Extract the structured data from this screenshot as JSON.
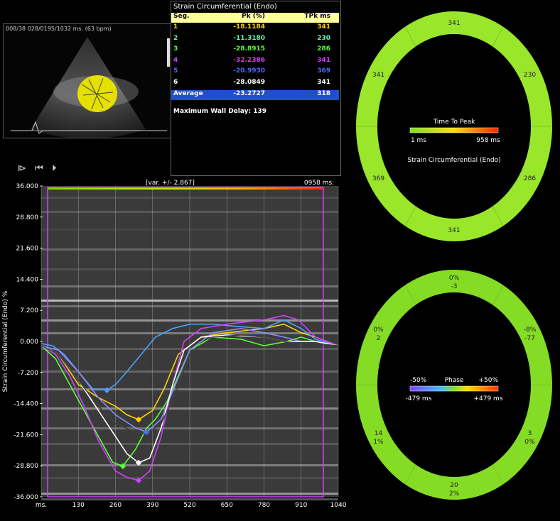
{
  "echo": {
    "header": "008/38  028/0195/1032 ms. (63 bpm)",
    "note": "ECG"
  },
  "table": {
    "title": "Strain Circumferential (Endo)",
    "headers": [
      "Seg.",
      "Pk (%)",
      "TPk ms"
    ],
    "rows": [
      {
        "seg": "1",
        "pk": "-18.1184",
        "tpk": "341",
        "color": "#ffd000"
      },
      {
        "seg": "2",
        "pk": "-11.3180",
        "tpk": "230",
        "color": "#60ffb0"
      },
      {
        "seg": "3",
        "pk": "-28.8915",
        "tpk": "286",
        "color": "#5cff3a"
      },
      {
        "seg": "4",
        "pk": "-32.2386",
        "tpk": "341",
        "color": "#d040ff"
      },
      {
        "seg": "5",
        "pk": "-20.9930",
        "tpk": "369",
        "color": "#4a6bff"
      },
      {
        "seg": "6",
        "pk": "-28.0849",
        "tpk": "341",
        "color": "#ffffff"
      }
    ],
    "average": {
      "label": "Average",
      "pk": "-23.2727",
      "tpk": "318"
    },
    "max_wall_delay": "Maximum Wall Delay: 139"
  },
  "controls": {
    "play_label": "⧐ ⏮ ⏵"
  },
  "chart_data": {
    "type": "line",
    "ylabel": "Strain Circumferential (Endo)  %",
    "xlabel": "ms.",
    "top_left_label": "[var. +/- 2.867]",
    "top_right_label": "0958 ms.",
    "y_ticks": [
      "36.000",
      "28.800",
      "21.600",
      "14.400",
      "7.200",
      "0.000",
      "-7.200",
      "-14.400",
      "-21.600",
      "-28.800",
      "-36.000"
    ],
    "x_ticks": [
      "ms.",
      "130",
      "260",
      "390",
      "520",
      "650",
      "780",
      "910",
      "1040"
    ],
    "ylim": [
      -36,
      36
    ],
    "xlim": [
      0,
      1040
    ],
    "series": [
      {
        "color": "#ffd000",
        "x": [
          0,
          60,
          130,
          200,
          260,
          300,
          341,
          390,
          430,
          480,
          560,
          650,
          780,
          850,
          910,
          960,
          1000,
          1040
        ],
        "y": [
          -1,
          -3,
          -10,
          -13,
          -15,
          -17,
          -18.1,
          -16,
          -11,
          -3,
          1,
          2,
          3,
          4,
          2,
          1,
          0,
          -1
        ]
      },
      {
        "color": "#4aa0ff",
        "x": [
          0,
          40,
          80,
          130,
          180,
          230,
          260,
          300,
          350,
          400,
          460,
          520,
          600,
          680,
          780,
          850,
          910,
          960,
          1040
        ],
        "y": [
          -0.5,
          -1,
          -3,
          -7,
          -11,
          -11.3,
          -10,
          -7,
          -3,
          1,
          3,
          4,
          4,
          3.5,
          3,
          5,
          3,
          0.5,
          -1
        ]
      },
      {
        "color": "#5cff3a",
        "x": [
          0,
          50,
          100,
          150,
          200,
          250,
          286,
          330,
          370,
          400,
          440,
          480,
          520,
          600,
          700,
          780,
          860,
          910,
          960,
          1040
        ],
        "y": [
          -1,
          -4,
          -10,
          -16,
          -22,
          -28,
          -28.9,
          -25,
          -20,
          -18,
          -14,
          -8,
          -2,
          1,
          0.5,
          -1,
          0,
          1,
          0,
          -1
        ]
      },
      {
        "color": "#d040ff",
        "x": [
          0,
          50,
          100,
          150,
          200,
          260,
          300,
          341,
          380,
          420,
          460,
          500,
          560,
          650,
          780,
          850,
          900,
          960,
          1040
        ],
        "y": [
          -1,
          -3,
          -8,
          -15,
          -23,
          -30,
          -31.5,
          -32.2,
          -30,
          -22,
          -10,
          0,
          3,
          4,
          5,
          6,
          5,
          1,
          -1
        ]
      },
      {
        "color": "#8a8cff",
        "x": [
          0,
          60,
          130,
          200,
          260,
          330,
          369,
          420,
          470,
          520,
          600,
          700,
          780,
          850,
          910,
          960,
          1040
        ],
        "y": [
          -1,
          -2,
          -7,
          -13,
          -17,
          -20,
          -21,
          -18,
          -10,
          -2,
          2,
          3,
          2,
          1,
          0,
          0,
          -1
        ]
      },
      {
        "color": "#ffffff",
        "x": [
          0,
          60,
          130,
          200,
          260,
          300,
          341,
          380,
          420,
          460,
          500,
          560,
          650,
          780,
          850,
          910,
          960,
          1040
        ],
        "y": [
          -1,
          -3,
          -9,
          -16,
          -22,
          -26,
          -28.1,
          -27,
          -20,
          -10,
          -2,
          1,
          1.5,
          1,
          0,
          0,
          0,
          -1
        ]
      },
      {
        "color": "#404040",
        "x": [
          0,
          60,
          130,
          200,
          260,
          330,
          369,
          420,
          470,
          520,
          600,
          700,
          780,
          850,
          910,
          960,
          1040
        ],
        "y": [
          -1,
          -3,
          -9,
          -15,
          -19,
          -21,
          -21.5,
          -19,
          -12,
          -3,
          1,
          1.5,
          1,
          0,
          -0.5,
          -0.5,
          -1
        ]
      }
    ],
    "markers": [
      {
        "x": 230,
        "y": -11.3,
        "color": "#4aa0ff"
      },
      {
        "x": 341,
        "y": -18.1,
        "color": "#ffd000"
      },
      {
        "x": 286,
        "y": -28.9,
        "color": "#5cff3a"
      },
      {
        "x": 341,
        "y": -32.2,
        "color": "#d040ff"
      },
      {
        "x": 341,
        "y": -28.1,
        "color": "#ffffff"
      },
      {
        "x": 369,
        "y": -21.0,
        "color": "#4a6bff"
      }
    ]
  },
  "ring_tpk": {
    "segments": [
      "341",
      "230",
      "286",
      "341",
      "369",
      "341"
    ],
    "legend_title": "Time To Peak",
    "legend_min": "1 ms",
    "legend_max": "958 ms",
    "caption": "Strain Circumferential (Endo)",
    "ring_color": "#9ae62a"
  },
  "ring_phase": {
    "segments": [
      {
        "top": "0%",
        "bottom": "-3"
      },
      {
        "top": "-8%",
        "bottom": "-77"
      },
      {
        "top": "3",
        "bottom": "0%"
      },
      {
        "top": "20",
        "bottom": "2%"
      },
      {
        "top": "14",
        "bottom": "1%"
      },
      {
        "top": "0%",
        "bottom": "2"
      }
    ],
    "legend_title": "Phase",
    "legend_neg": "-50%",
    "legend_pos": "+50%",
    "legend_min": "-479 ms",
    "legend_max": "+479 ms",
    "ring_color": "#84dc24"
  }
}
